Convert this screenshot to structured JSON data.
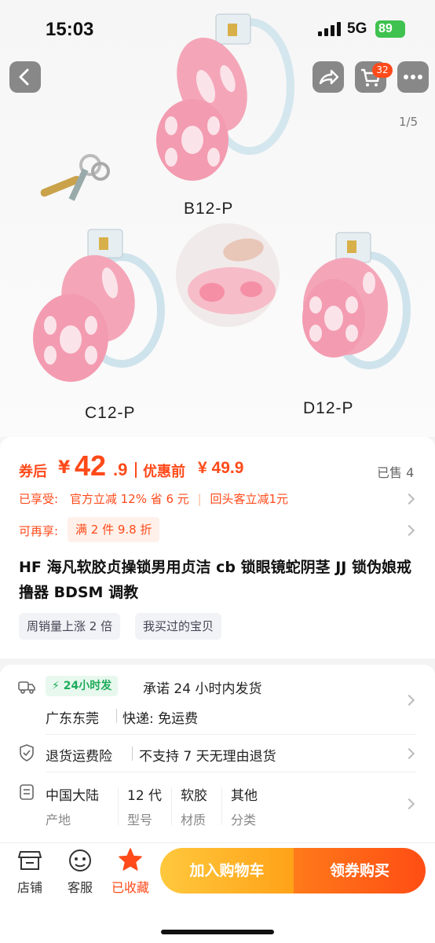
{
  "status_bar": {
    "time": "15:03",
    "network": "5G",
    "battery": "89"
  },
  "gallery": {
    "page_indicator": "1/5",
    "cart_count": "32",
    "model_labels": [
      "B12-P",
      "C12-P",
      "D12-P"
    ]
  },
  "price": {
    "after_coupon_label": "券后",
    "currency": "¥",
    "after_coupon_int": "42",
    "after_coupon_dec": ".9",
    "before_label": "优惠前",
    "before_price": "¥ 49.9",
    "sold": "已售 4"
  },
  "promos": {
    "enjoyed_label": "已享受:",
    "enjoyed_1": "官方立减 12% 省 6 元",
    "enjoyed_2": "回头客立减1元",
    "more_label": "可再享:",
    "more_value": "满 2 件 9.8 折"
  },
  "product": {
    "title": "HF 海凡软胶贞操锁男用贞洁 cb 锁眼镜蛇阴茎 JJ 锁伪娘戒撸器 BDSM 调教",
    "tags": [
      "周销量上涨 2 倍",
      "我买过的宝贝"
    ]
  },
  "shipping": {
    "badge": "24小时发",
    "promise": "承诺 24 小时内发货",
    "origin": "广东东莞",
    "delivery": "快递: 免运费"
  },
  "returns": {
    "insurance": "退货运费险",
    "policy": "不支持 7 天无理由退货"
  },
  "specs": [
    {
      "value": "中国大陆",
      "label": "产地"
    },
    {
      "value": "12 代",
      "label": "型号"
    },
    {
      "value": "软胶",
      "label": "材质"
    },
    {
      "value": "其他",
      "label": "分类"
    }
  ],
  "bottom_bar": {
    "shop": "店铺",
    "service": "客服",
    "favorited": "已收藏",
    "add_to_cart": "加入购物车",
    "buy_with_coupon": "领券购买"
  },
  "colors": {
    "accent": "#ff4a1a",
    "green": "#1fab5b",
    "product_pink": "#f4a6b8"
  }
}
